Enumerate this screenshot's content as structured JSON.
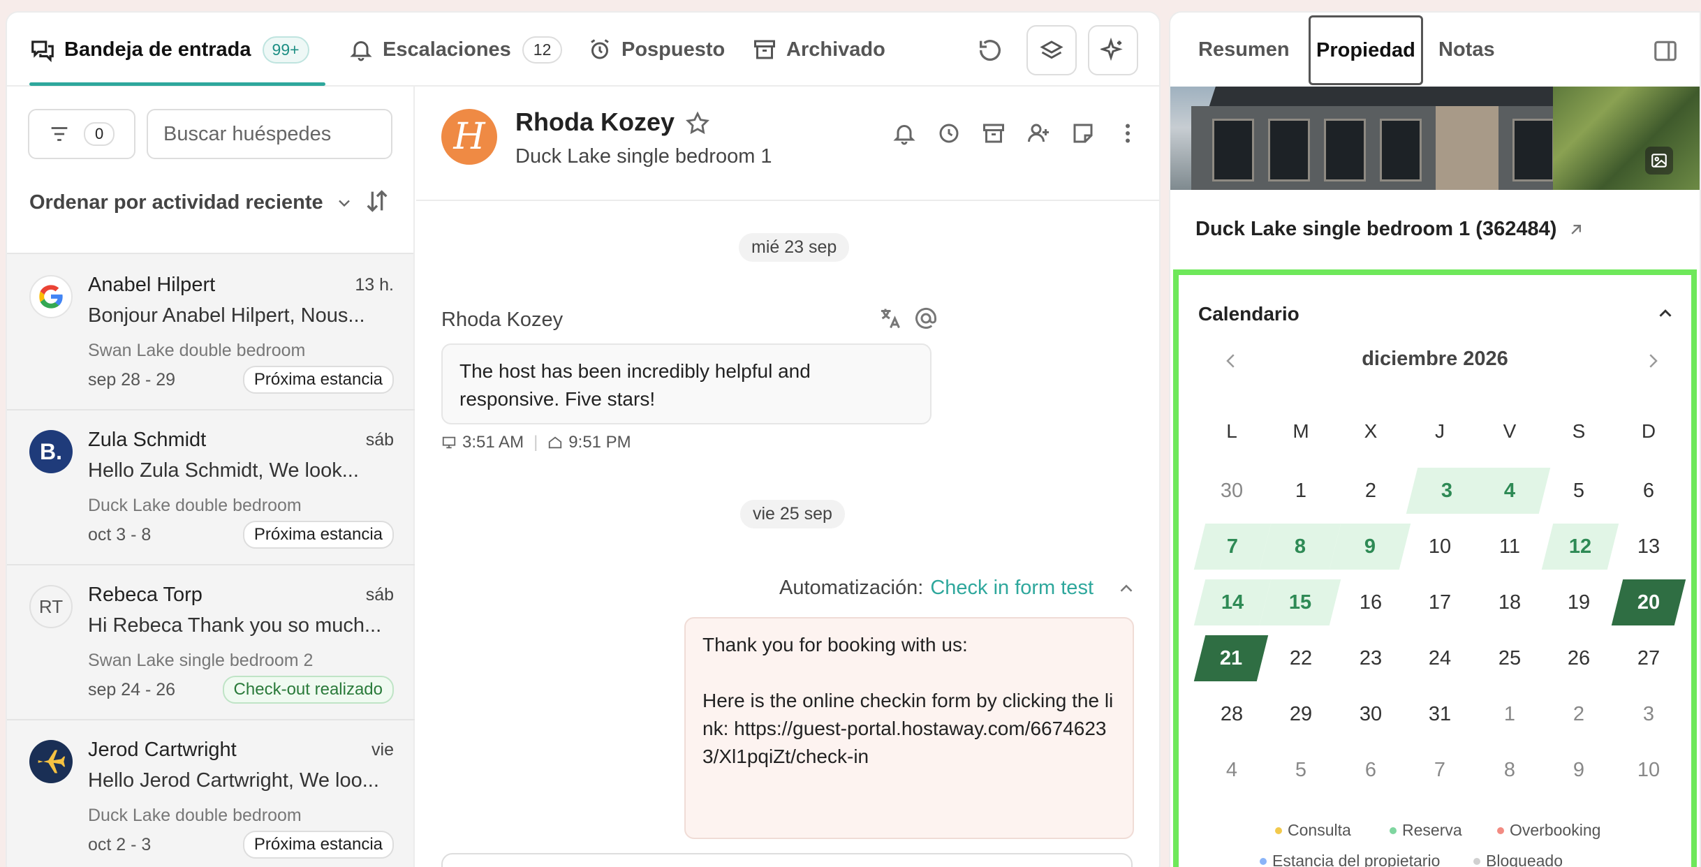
{
  "topnav": {
    "tabs": [
      {
        "label": "Bandeja de entrada",
        "badge": "99+"
      },
      {
        "label": "Escalaciones",
        "badge": "12"
      },
      {
        "label": "Pospuesto"
      },
      {
        "label": "Archivado"
      }
    ]
  },
  "list": {
    "filter_count": "0",
    "search_placeholder": "Buscar huéspedes",
    "sort_label": "Ordenar por actividad reciente",
    "conversations": [
      {
        "name": "Anabel Hilpert",
        "time": "13 h.",
        "preview": "Bonjour Anabel Hilpert, Nous...",
        "property": "Swan Lake double bedroom",
        "dates": "sep 28 - 29",
        "status": "Próxima estancia"
      },
      {
        "name": "Zula Schmidt",
        "time": "sáb",
        "preview": "Hello Zula Schmidt, We look...",
        "property": "Duck Lake double bedroom",
        "dates": "oct 3 - 8",
        "status": "Próxima estancia"
      },
      {
        "name": "Rebeca Torp",
        "initials": "RT",
        "time": "sáb",
        "preview": "Hi Rebeca Thank you so much...",
        "property": "Swan Lake single bedroom 2",
        "dates": "sep 24 - 26",
        "status": "Check-out realizado"
      },
      {
        "name": "Jerod Cartwright",
        "time": "vie",
        "preview": "Hello Jerod Cartwright, We loo...",
        "property": "Duck Lake double bedroom",
        "dates": "oct 2 - 3",
        "status": "Próxima estancia"
      }
    ]
  },
  "conversation": {
    "guest_name": "Rhoda Kozey",
    "guest_initial": "H",
    "listing": "Duck Lake single bedroom 1",
    "date1": "mié 23 sep",
    "sender": "Rhoda Kozey",
    "message_in": "The host has been incredibly helpful and responsive. Five stars!",
    "time_sent": "3:51 AM",
    "time_local": "9:51 PM",
    "date2": "vie 25 sep",
    "automation_label": "Automatización:",
    "automation_link": "Check in form test",
    "message_out": "Thank you for booking with us:\n\nHere is the online checkin form by clicking the link: https://guest-portal.hostaway.com/66746233/Xl1pqiZt/check-in"
  },
  "side": {
    "tabs": [
      "Resumen",
      "Propiedad",
      "Notas"
    ],
    "property_title": "Duck Lake single bedroom 1 (362484)",
    "calendar_title": "Calendario",
    "month": "diciembre 2026",
    "weekdays": [
      "L",
      "M",
      "X",
      "J",
      "V",
      "S",
      "D"
    ],
    "weeks": [
      [
        "30",
        "1",
        "2",
        "3",
        "4",
        "5",
        "6"
      ],
      [
        "7",
        "8",
        "9",
        "10",
        "11",
        "12",
        "13"
      ],
      [
        "14",
        "15",
        "16",
        "17",
        "18",
        "19",
        "20"
      ],
      [
        "21",
        "22",
        "23",
        "24",
        "25",
        "26",
        "27"
      ],
      [
        "28",
        "29",
        "30",
        "31",
        "1",
        "2",
        "3"
      ],
      [
        "4",
        "5",
        "6",
        "7",
        "8",
        "9",
        "10"
      ]
    ],
    "legend": [
      {
        "label": "Consulta",
        "color": "#f2c94c"
      },
      {
        "label": "Reserva",
        "color": "#7fd6a0"
      },
      {
        "label": "Overbooking",
        "color": "#f28b82"
      },
      {
        "label": "Estancia del propietario",
        "color": "#8ab4f8"
      },
      {
        "label": "Bloqueado",
        "color": "#d0d0d0"
      }
    ]
  },
  "colors": {
    "accent": "#2ea79c",
    "booked": "#e1f5e6",
    "selected": "#2f6e43",
    "highlight": "#6ee85a"
  }
}
